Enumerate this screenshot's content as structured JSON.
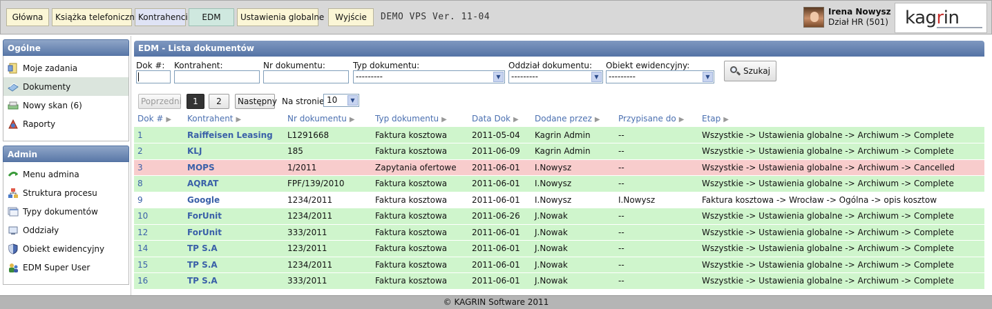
{
  "topnav": [
    {
      "label": "Główna",
      "style": "yellow"
    },
    {
      "label": "Książka telefoniczna",
      "style": "yellow"
    },
    {
      "label": "Kontrahenci",
      "style": "blue"
    },
    {
      "label": "EDM",
      "style": "teal"
    },
    {
      "label": "Ustawienia globalne",
      "style": "yellow"
    },
    {
      "label": "Wyjście",
      "style": "yellow"
    }
  ],
  "demo_text": "DEMO VPS Ver. 11-04",
  "user": {
    "name": "Irena Nowysz",
    "dept": "Dział HR (501)"
  },
  "logo": {
    "text_a": "kag",
    "text_r": "r",
    "text_b": "in"
  },
  "sidebar": {
    "sections": [
      {
        "title": "Ogólne",
        "items": [
          {
            "label": "Moje zadania",
            "icon": "tasks-icon",
            "active": false
          },
          {
            "label": "Dokumenty",
            "icon": "documents-icon",
            "active": true
          },
          {
            "label": "Nowy skan (6)",
            "icon": "scan-icon",
            "active": false
          },
          {
            "label": "Raporty",
            "icon": "reports-icon",
            "active": false
          }
        ]
      },
      {
        "title": "Admin",
        "items": [
          {
            "label": "Menu admina",
            "icon": "admin-menu-icon",
            "active": false
          },
          {
            "label": "Struktura procesu",
            "icon": "process-structure-icon",
            "active": false
          },
          {
            "label": "Typy dokumentów",
            "icon": "document-types-icon",
            "active": false
          },
          {
            "label": "Oddziały",
            "icon": "branches-icon",
            "active": false
          },
          {
            "label": "Obiekt ewidencyjny",
            "icon": "shield-icon",
            "active": false
          },
          {
            "label": "EDM Super User",
            "icon": "super-user-icon",
            "active": false
          }
        ]
      }
    ]
  },
  "main": {
    "title": "EDM - Lista dokumentów",
    "filters": {
      "dok_label": "Dok #:",
      "kontrahent_label": "Kontrahent:",
      "nr_label": "Nr dokumentu:",
      "typ_label": "Typ dokumentu:",
      "typ_value": "---------",
      "oddzial_label": "Oddział dokumentu:",
      "oddzial_value": "---------",
      "obiekt_label": "Obiekt ewidencyjny:",
      "obiekt_value": "---------",
      "search_label": "Szukaj"
    },
    "pager": {
      "prev": "Poprzedni",
      "pages": [
        "1",
        "2"
      ],
      "current": "1",
      "next": "Następny",
      "per_page_label": "Na stronie",
      "per_page_value": "10"
    },
    "table": {
      "columns": [
        "Dok #",
        "Kontrahent",
        "Nr dokumentu",
        "Typ dokumentu",
        "Data Dok",
        "Dodane przez",
        "Przypisane do",
        "Etap"
      ],
      "rows": [
        {
          "status": "green",
          "cells": [
            "1",
            "Raiffeisen Leasing",
            "L1291668",
            "Faktura kosztowa",
            "2011-05-04",
            "Kagrin Admin",
            "--",
            "Wszystkie -> Ustawienia globalne -> Archiwum -> Complete"
          ]
        },
        {
          "status": "green",
          "cells": [
            "2",
            "KLJ",
            "185",
            "Faktura kosztowa",
            "2011-06-09",
            "Kagrin Admin",
            "--",
            "Wszystkie -> Ustawienia globalne -> Archiwum -> Complete"
          ]
        },
        {
          "status": "red",
          "cells": [
            "3",
            "MOPS",
            "1/2011",
            "Zapytania ofertowe",
            "2011-06-01",
            "I.Nowysz",
            "--",
            "Wszystkie -> Ustawienia globalne -> Archiwum -> Cancelled"
          ]
        },
        {
          "status": "green",
          "cells": [
            "8",
            "AQRAT",
            "FPF/139/2010",
            "Faktura kosztowa",
            "2011-06-01",
            "I.Nowysz",
            "--",
            "Wszystkie -> Ustawienia globalne -> Archiwum -> Complete"
          ]
        },
        {
          "status": "white",
          "cells": [
            "9",
            "Google",
            "1234/2011",
            "Faktura kosztowa",
            "2011-06-01",
            "I.Nowysz",
            "I.Nowysz",
            "Faktura kosztowa -> Wrocław -> Ogólna -> opis kosztow"
          ]
        },
        {
          "status": "green",
          "cells": [
            "10",
            "ForUnit",
            "1234/2011",
            "Faktura kosztowa",
            "2011-06-26",
            "J.Nowak",
            "--",
            "Wszystkie -> Ustawienia globalne -> Archiwum -> Complete"
          ]
        },
        {
          "status": "green",
          "cells": [
            "12",
            "ForUnit",
            "333/2011",
            "Faktura kosztowa",
            "2011-06-01",
            "J.Nowak",
            "--",
            "Wszystkie -> Ustawienia globalne -> Archiwum -> Complete"
          ]
        },
        {
          "status": "green",
          "cells": [
            "14",
            "TP S.A",
            "123/2011",
            "Faktura kosztowa",
            "2011-06-01",
            "J.Nowak",
            "--",
            "Wszystkie -> Ustawienia globalne -> Archiwum -> Complete"
          ]
        },
        {
          "status": "green",
          "cells": [
            "15",
            "TP S.A",
            "1234/2011",
            "Faktura kosztowa",
            "2011-06-01",
            "J.Nowak",
            "--",
            "Wszystkie -> Ustawienia globalne -> Archiwum -> Complete"
          ]
        },
        {
          "status": "green",
          "cells": [
            "16",
            "TP S.A",
            "333/2011",
            "Faktura kosztowa",
            "2011-06-01",
            "J.Nowak",
            "--",
            "Wszystkie -> Ustawienia globalne -> Archiwum -> Complete"
          ]
        }
      ]
    }
  },
  "footer": "© KAGRIN Software 2011",
  "colors": {
    "row_green": "#cff5cc",
    "row_red": "#f8cccc",
    "header_blue": "#5473a5",
    "link_blue": "#3a60a8"
  }
}
